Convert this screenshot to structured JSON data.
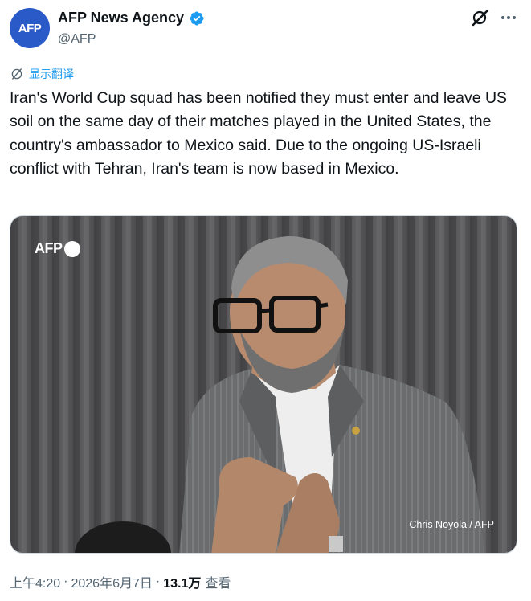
{
  "author": {
    "avatar_text": "AFP",
    "display_name": "AFP News Agency",
    "handle": "@AFP"
  },
  "actions": {
    "grok_icon": "grok-icon",
    "more_icon": "more-horizontal-icon"
  },
  "translate": {
    "label": "显示翻译"
  },
  "tweet": {
    "text": "Iran's World Cup squad has been notified they must enter and leave US soil on the same day of their matches played in the United States, the country's ambassador to Mexico said. Due to the ongoing US-Israeli conflict with Tehran, Iran's team is now based in Mexico."
  },
  "media": {
    "watermark": "AFP",
    "credit": "Chris Noyola / AFP"
  },
  "meta": {
    "time": "上午4:20",
    "separator": "·",
    "date": "2026年6月7日",
    "views_count": "13.1万",
    "views_label": "查看"
  },
  "colors": {
    "accent": "#1d9bf0",
    "avatar_bg": "#2a59c8",
    "text_primary": "#0f1419",
    "text_secondary": "#536471"
  }
}
